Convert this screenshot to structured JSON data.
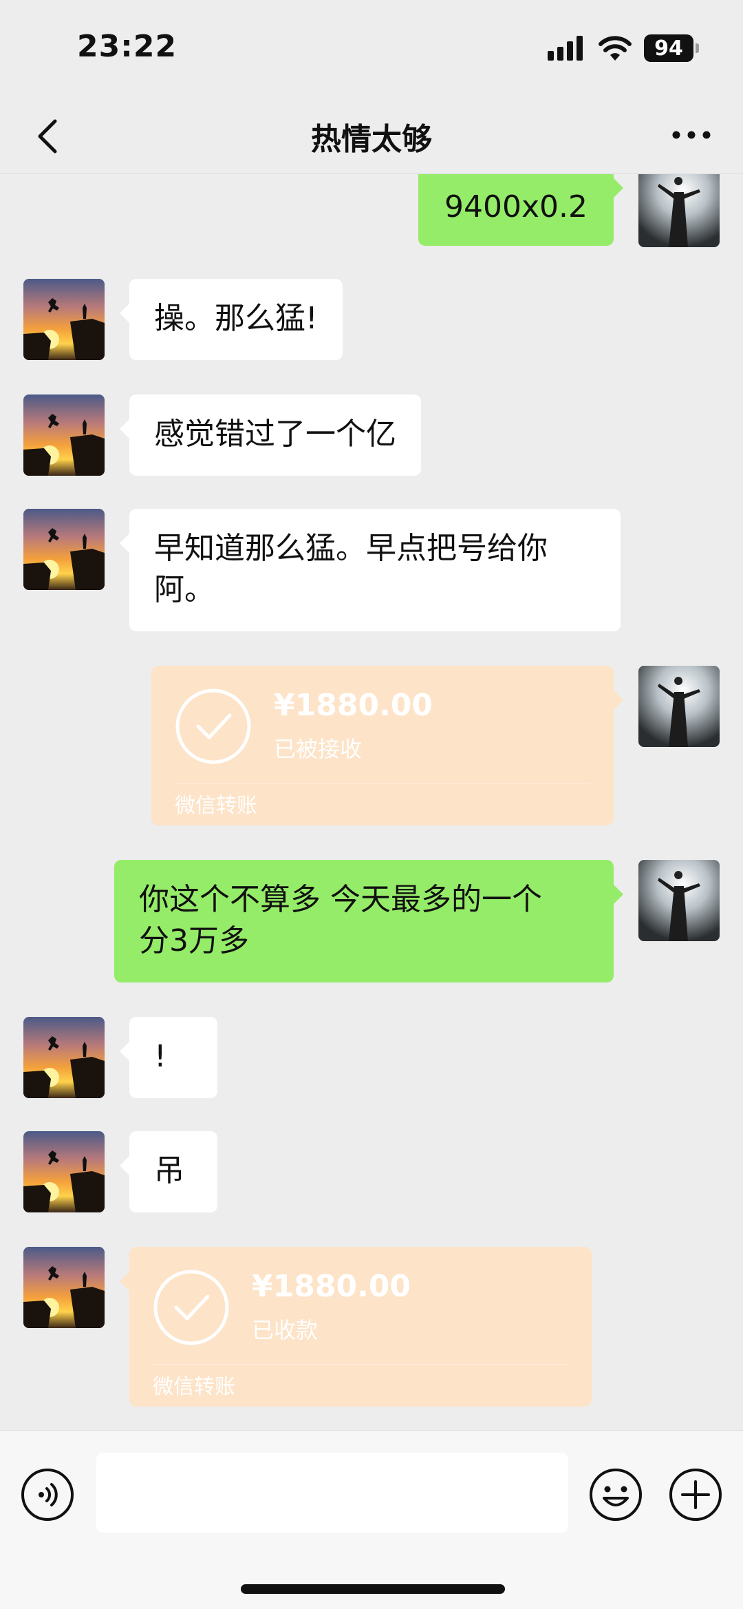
{
  "status_bar": {
    "time": "23:22",
    "battery": "94"
  },
  "nav": {
    "title": "热情太够"
  },
  "messages": {
    "m1": {
      "text": "9400x0.2"
    },
    "m2": {
      "text": "操。那么猛!"
    },
    "m3": {
      "text": "感觉错过了一个亿"
    },
    "m4": {
      "line1": "早知道那么猛。早点把号给你",
      "line2": "阿。"
    },
    "m5": {
      "amount": "¥1880.00",
      "status": "已被接收",
      "brand": "微信转账"
    },
    "m6": {
      "line1": "你这个不算多 今天最多的一个",
      "line2": "分3万多"
    },
    "m7": {
      "text": "!"
    },
    "m8": {
      "text": "吊"
    },
    "m9": {
      "amount": "¥1880.00",
      "status": "已收款",
      "brand": "微信转账"
    }
  },
  "colors": {
    "background": "#ededed",
    "sent_bubble": "#95ec69",
    "received_bubble": "#ffffff",
    "transfer_card": "#fde3c8"
  },
  "icons": [
    "back-icon",
    "more-icon",
    "wifi-icon",
    "signal-icon",
    "check-icon",
    "voice-icon",
    "emoji-icon",
    "plus-icon"
  ]
}
